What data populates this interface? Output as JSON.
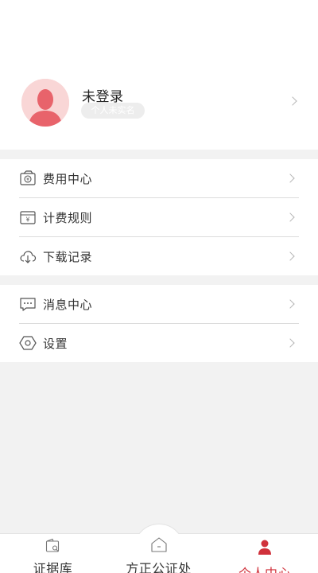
{
  "profile": {
    "name": "未登录",
    "verify_status": "个人未实名"
  },
  "menu_group_1": [
    {
      "label": "费用中心",
      "icon": "money-bag-icon"
    },
    {
      "label": "计费规则",
      "icon": "billing-yen-icon"
    },
    {
      "label": "下载记录",
      "icon": "cloud-download-icon"
    }
  ],
  "menu_group_2": [
    {
      "label": "消息中心",
      "icon": "message-icon"
    },
    {
      "label": "设置",
      "icon": "settings-hexagon-icon"
    }
  ],
  "tabbar": {
    "evidence": "证据库",
    "notary": "方正公证处",
    "personal": "个人中心",
    "active": "personal"
  },
  "colors": {
    "accent": "#d0313b",
    "avatar_bg": "#f9d6d6",
    "avatar_figure": "#e8636b",
    "background": "#f2f2f2"
  }
}
